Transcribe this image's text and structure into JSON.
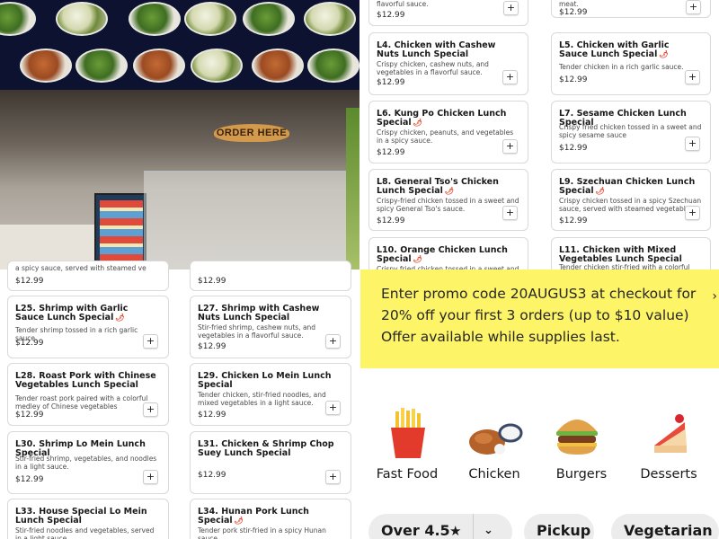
{
  "photo": {
    "sign_text": "ORDER HERE"
  },
  "icons": {
    "add": "plus-icon",
    "spicy": "chili-pepper-icon",
    "star": "star-icon",
    "chevron": "chevron-down-icon",
    "arrow": "chevron-right-icon"
  },
  "colors": {
    "promo_bg": "#fdf467",
    "spicy": "#e1462c",
    "pill_bg": "#ececec"
  },
  "right_menu": {
    "top_left": {
      "desc": "flavorful sauce.",
      "price": "$12.99"
    },
    "top_right": {
      "desc": "meat.",
      "price": "$12.99"
    },
    "items": [
      {
        "title": "L4. Chicken with Cashew Nuts Lunch Special",
        "desc": "Crispy chicken, cashew nuts, and vegetables in a flavorful sauce.",
        "price": "$12.99",
        "spicy": false
      },
      {
        "title": "L5. Chicken with Garlic Sauce Lunch Special",
        "desc": "Tender chicken in a rich garlic sauce.",
        "price": "$12.99",
        "spicy": true
      },
      {
        "title": "L6. Kung Po Chicken Lunch Special",
        "desc": "Crispy chicken, peanuts, and vegetables in a spicy sauce.",
        "price": "$12.99",
        "spicy": true
      },
      {
        "title": "L7. Sesame Chicken Lunch Special",
        "desc": "Crispy fried chicken tossed in a sweet and spicy sesame sauce",
        "price": "$12.99",
        "spicy": false
      },
      {
        "title": "L8. General Tso's Chicken Lunch Special",
        "desc": "Crispy-fried chicken tossed in a sweet and spicy General Tso's sauce.",
        "price": "$12.99",
        "spicy": true
      },
      {
        "title": "L9. Szechuan Chicken Lunch Special",
        "desc": "Crispy chicken tossed in a spicy Szechuan sauce, served with steamed vegetables",
        "price": "$12.99",
        "spicy": true
      },
      {
        "title": "L10. Orange Chicken Lunch Special",
        "desc": "Crispy fried chicken tossed in a sweet and",
        "price": "",
        "spicy": true
      },
      {
        "title": "L11. Chicken with Mixed Vegetables Lunch Special",
        "desc": "Tender chicken stir-fried with a colorful mix",
        "price": "",
        "spicy": false
      }
    ]
  },
  "left_menu": {
    "top_left": {
      "desc": "a spicy sauce, served with steamed ve",
      "price": "$12.99"
    },
    "top_right": {
      "price": "$12.99"
    },
    "items": [
      {
        "title": "L25. Shrimp with Garlic Sauce Lunch Special",
        "desc": "Tender shrimp tossed in a rich garlic sauce.",
        "price": "$12.99",
        "spicy": true
      },
      {
        "title": "L27. Shrimp with Cashew Nuts Lunch Special",
        "desc": "Stir-fried shrimp, cashew nuts, and vegetables in a flavorful sauce.",
        "price": "$12.99",
        "spicy": false
      },
      {
        "title": "L28. Roast Pork with Chinese Vegetables Lunch Special",
        "desc": "Tender roast pork paired with a colorful medley of Chinese vegetables",
        "price": "$12.99",
        "spicy": false
      },
      {
        "title": "L29. Chicken Lo Mein Lunch Special",
        "desc": "Tender chicken, stir-fried noodles, and mixed vegetables in a light sauce.",
        "price": "$12.99",
        "spicy": false
      },
      {
        "title": "L30. Shrimp Lo Mein Lunch Special",
        "desc": "Stir-fried shrimp, vegetables, and noodles in a light sauce.",
        "price": "$12.99",
        "spicy": false
      },
      {
        "title": "L31. Chicken & Shrimp Chop Suey Lunch Special",
        "desc": "",
        "price": "$12.99",
        "spicy": false
      },
      {
        "title": "L33. House Special Lo Mein Lunch Special",
        "desc": "Stir-fried noodles and vegetables, served in a light sauce.",
        "price": "",
        "spicy": false
      },
      {
        "title": "L34. Hunan Pork Lunch Special",
        "desc": "Tender pork stir-fried in a spicy Hunan sauce.",
        "price": "",
        "spicy": true
      }
    ]
  },
  "promo": {
    "text": "Enter promo code 20AUGUS3 at checkout for 20% off your first 3 orders (up to $10 value) Offer available while supplies last."
  },
  "categories": [
    {
      "label": "Fast Food",
      "icon": "fries-icon"
    },
    {
      "label": "Chicken",
      "icon": "fried-chicken-icon"
    },
    {
      "label": "Burgers",
      "icon": "burger-icon"
    },
    {
      "label": "Desserts",
      "icon": "cake-icon"
    }
  ],
  "filters": {
    "rating": "Over 4.5",
    "pickup": "Pickup",
    "vegetarian": "Vegetarian"
  }
}
